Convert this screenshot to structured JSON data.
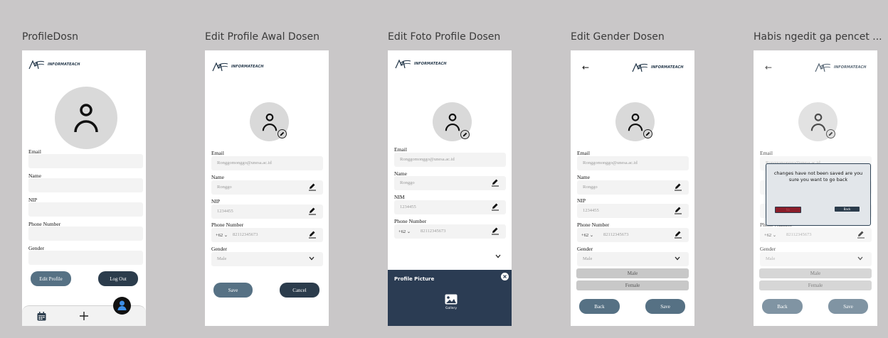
{
  "frames": [
    {
      "title": "ProfileDosn",
      "logo_text": "INFORMATEACH",
      "labels": {
        "email": "Email",
        "name": "Name",
        "nip": "NIP",
        "phone": "Phone Number",
        "gender": "Gender"
      },
      "buttons": {
        "edit": "Edit Profile",
        "logout": "Log Out"
      },
      "nav_icons": [
        "calendar-icon",
        "plus-icon",
        "user-icon"
      ]
    },
    {
      "title": "Edit Profile Awal Dosen",
      "logo_text": "INFORMATEACH",
      "labels": {
        "email": "Email",
        "name": "Name",
        "nip": "NIP",
        "phone": "Phone Number",
        "gender": "Gender"
      },
      "values": {
        "email": "Ronggomonggo@unesa.ac.id",
        "name": "Ronggo",
        "nip": "1234455",
        "country_code": "+62 ⌄",
        "phone": "82112345673",
        "gender": "Male"
      },
      "buttons": {
        "save": "Save",
        "cancel": "Cancel"
      }
    },
    {
      "title": "Edit Foto Profile Dosen",
      "logo_text": "INFORMATEACH",
      "labels": {
        "email": "Email",
        "name": "Name",
        "nim": "NIM",
        "phone": "Phone Number"
      },
      "values": {
        "email": "Ronggomonggo@unesa.ac.id",
        "name": "Ronggo",
        "nim": "1234455",
        "country_code": "+62 ⌄",
        "phone": "82112345673"
      },
      "sheet": {
        "title": "Profile Picture",
        "gallery": "Gallery"
      }
    },
    {
      "title": "Edit Gender Dosen",
      "logo_text": "INFORMATEACH",
      "labels": {
        "email": "Email",
        "name": "Name",
        "nip": "NIP",
        "phone": "Phone Number",
        "gender": "Gender"
      },
      "values": {
        "email": "Ronggomonggo@unesa.ac.id",
        "name": "Ronggo",
        "nip": "1234455",
        "country_code": "+62 ⌄",
        "phone": "82112345673",
        "gender": "Male"
      },
      "options": [
        "Male",
        "Female"
      ],
      "buttons": {
        "back": "Back",
        "save": "Save"
      }
    },
    {
      "title": "Habis ngedit ga pencet ...",
      "logo_text": "INFORMATEACH",
      "labels": {
        "email": "Email",
        "phone": "Phone Number",
        "gender": "Gender"
      },
      "values": {
        "email": "Ronggomonggo@unesa.ac.id",
        "country_code": "+62 ⌄",
        "phone": "82112345673",
        "gender": "Male"
      },
      "options": [
        "Male",
        "Female"
      ],
      "buttons": {
        "back": "Back",
        "save": "Save"
      },
      "dialog": {
        "message": "changes have not been saved are you sure you want to go back",
        "no": "No",
        "back": "Back"
      }
    }
  ],
  "colors": {
    "background": "#c9c7c8",
    "primary_dark": "#2b3c4c",
    "primary_light": "#567184",
    "sheet": "#2b3c53",
    "danger": "#8b1e2a"
  }
}
